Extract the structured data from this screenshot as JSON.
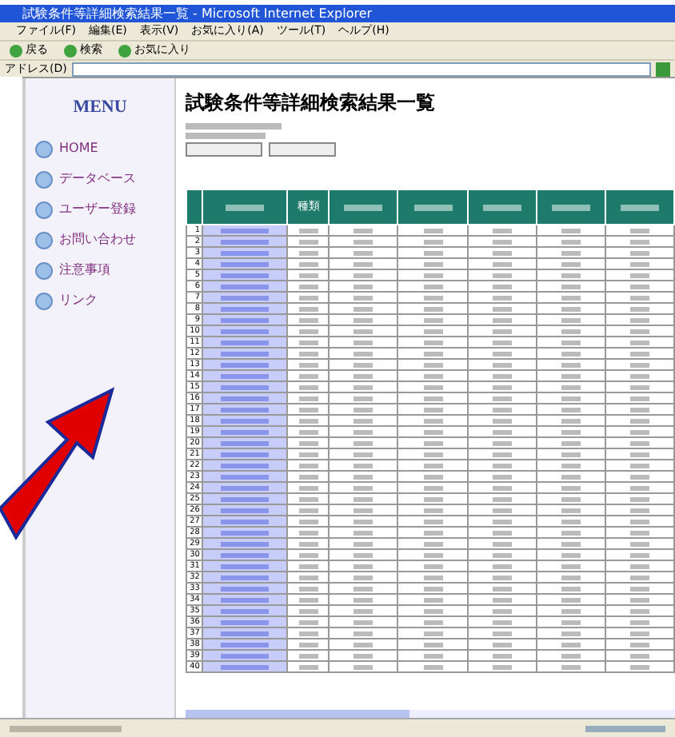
{
  "window": {
    "title": "試験条件等詳細検索結果一覧 - Microsoft Internet Explorer"
  },
  "menu_bar": [
    "ファイル(F)",
    "編集(E)",
    "表示(V)",
    "お気に入り(A)",
    "ツール(T)",
    "ヘルプ(H)"
  ],
  "toolbar": [
    "戻る",
    "検索",
    "お気に入り"
  ],
  "address_bar": {
    "label": "アドレス(D)"
  },
  "sidebar": {
    "title": "MENU",
    "items": [
      "HOME",
      "データベース",
      "ユーザー登録",
      "お問い合わせ",
      "注意事項",
      "リンク"
    ]
  },
  "page": {
    "title": "試験条件等詳細検索結果一覧"
  },
  "table": {
    "columns": [
      {
        "kind": "blur"
      },
      {
        "kind": "text",
        "label": "種類"
      },
      {
        "kind": "blur"
      },
      {
        "kind": "blur"
      },
      {
        "kind": "blur"
      },
      {
        "kind": "blur"
      },
      {
        "kind": "blur"
      }
    ],
    "rows": [
      "1",
      "2",
      "3",
      "4",
      "5",
      "6",
      "7",
      "8",
      "9",
      "10",
      "11",
      "12",
      "13",
      "14",
      "15",
      "16",
      "17",
      "18",
      "19",
      "20",
      "21",
      "22",
      "23",
      "24",
      "25",
      "26",
      "27",
      "28",
      "29",
      "30",
      "31",
      "32",
      "33",
      "34",
      "35",
      "36",
      "37",
      "38",
      "39",
      "40"
    ]
  }
}
